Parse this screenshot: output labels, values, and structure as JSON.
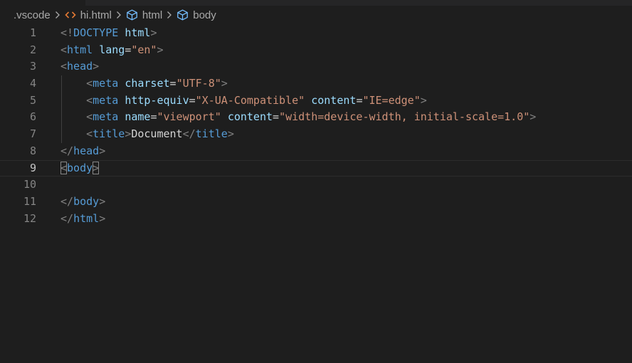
{
  "breadcrumb": {
    "items": [
      {
        "label": ".vscode",
        "icon": "none"
      },
      {
        "label": "hi.html",
        "icon": "html-file-icon"
      },
      {
        "label": "html",
        "icon": "element-cube-icon"
      },
      {
        "label": "body",
        "icon": "element-cube-icon"
      }
    ]
  },
  "editor": {
    "current_line": 9,
    "lines": [
      {
        "n": "1",
        "indent": 0,
        "tokens": [
          {
            "t": "<!",
            "c": "#808080"
          },
          {
            "t": "DOCTYPE",
            "c": "#569cd6"
          },
          {
            "t": " ",
            "c": "#d4d4d4"
          },
          {
            "t": "html",
            "c": "#9cdcfe"
          },
          {
            "t": ">",
            "c": "#808080"
          }
        ]
      },
      {
        "n": "2",
        "indent": 0,
        "tokens": [
          {
            "t": "<",
            "c": "#808080"
          },
          {
            "t": "html",
            "c": "#569cd6"
          },
          {
            "t": " ",
            "c": "#d4d4d4"
          },
          {
            "t": "lang",
            "c": "#9cdcfe"
          },
          {
            "t": "=",
            "c": "#d4d4d4"
          },
          {
            "t": "\"en\"",
            "c": "#ce9178"
          },
          {
            "t": ">",
            "c": "#808080"
          }
        ]
      },
      {
        "n": "3",
        "indent": 0,
        "tokens": [
          {
            "t": "<",
            "c": "#808080"
          },
          {
            "t": "head",
            "c": "#569cd6"
          },
          {
            "t": ">",
            "c": "#808080"
          }
        ]
      },
      {
        "n": "4",
        "indent": 1,
        "tokens": [
          {
            "t": "<",
            "c": "#808080"
          },
          {
            "t": "meta",
            "c": "#569cd6"
          },
          {
            "t": " ",
            "c": "#d4d4d4"
          },
          {
            "t": "charset",
            "c": "#9cdcfe"
          },
          {
            "t": "=",
            "c": "#d4d4d4"
          },
          {
            "t": "\"UTF-8\"",
            "c": "#ce9178"
          },
          {
            "t": ">",
            "c": "#808080"
          }
        ]
      },
      {
        "n": "5",
        "indent": 1,
        "tokens": [
          {
            "t": "<",
            "c": "#808080"
          },
          {
            "t": "meta",
            "c": "#569cd6"
          },
          {
            "t": " ",
            "c": "#d4d4d4"
          },
          {
            "t": "http-equiv",
            "c": "#9cdcfe"
          },
          {
            "t": "=",
            "c": "#d4d4d4"
          },
          {
            "t": "\"X-UA-Compatible\"",
            "c": "#ce9178"
          },
          {
            "t": " ",
            "c": "#d4d4d4"
          },
          {
            "t": "content",
            "c": "#9cdcfe"
          },
          {
            "t": "=",
            "c": "#d4d4d4"
          },
          {
            "t": "\"IE=edge\"",
            "c": "#ce9178"
          },
          {
            "t": ">",
            "c": "#808080"
          }
        ]
      },
      {
        "n": "6",
        "indent": 1,
        "tokens": [
          {
            "t": "<",
            "c": "#808080"
          },
          {
            "t": "meta",
            "c": "#569cd6"
          },
          {
            "t": " ",
            "c": "#d4d4d4"
          },
          {
            "t": "name",
            "c": "#9cdcfe"
          },
          {
            "t": "=",
            "c": "#d4d4d4"
          },
          {
            "t": "\"viewport\"",
            "c": "#ce9178"
          },
          {
            "t": " ",
            "c": "#d4d4d4"
          },
          {
            "t": "content",
            "c": "#9cdcfe"
          },
          {
            "t": "=",
            "c": "#d4d4d4"
          },
          {
            "t": "\"width=device-width, initial-scale=1.0\"",
            "c": "#ce9178"
          },
          {
            "t": ">",
            "c": "#808080"
          }
        ]
      },
      {
        "n": "7",
        "indent": 1,
        "tokens": [
          {
            "t": "<",
            "c": "#808080"
          },
          {
            "t": "title",
            "c": "#569cd6"
          },
          {
            "t": ">",
            "c": "#808080"
          },
          {
            "t": "Document",
            "c": "#d4d4d4"
          },
          {
            "t": "</",
            "c": "#808080"
          },
          {
            "t": "title",
            "c": "#569cd6"
          },
          {
            "t": ">",
            "c": "#808080"
          }
        ]
      },
      {
        "n": "8",
        "indent": 0,
        "tokens": [
          {
            "t": "</",
            "c": "#808080"
          },
          {
            "t": "head",
            "c": "#569cd6"
          },
          {
            "t": ">",
            "c": "#808080"
          }
        ]
      },
      {
        "n": "9",
        "indent": 0,
        "tokens": [
          {
            "t": "<",
            "c": "#808080",
            "box": true
          },
          {
            "t": "body",
            "c": "#569cd6"
          },
          {
            "t": ">",
            "c": "#808080",
            "box": true
          }
        ]
      },
      {
        "n": "10",
        "indent": 0,
        "tokens": []
      },
      {
        "n": "11",
        "indent": 0,
        "tokens": [
          {
            "t": "</",
            "c": "#808080"
          },
          {
            "t": "body",
            "c": "#569cd6"
          },
          {
            "t": ">",
            "c": "#808080"
          }
        ]
      },
      {
        "n": "12",
        "indent": 0,
        "tokens": [
          {
            "t": "</",
            "c": "#808080"
          },
          {
            "t": "html",
            "c": "#569cd6"
          },
          {
            "t": ">",
            "c": "#808080"
          }
        ]
      }
    ]
  }
}
